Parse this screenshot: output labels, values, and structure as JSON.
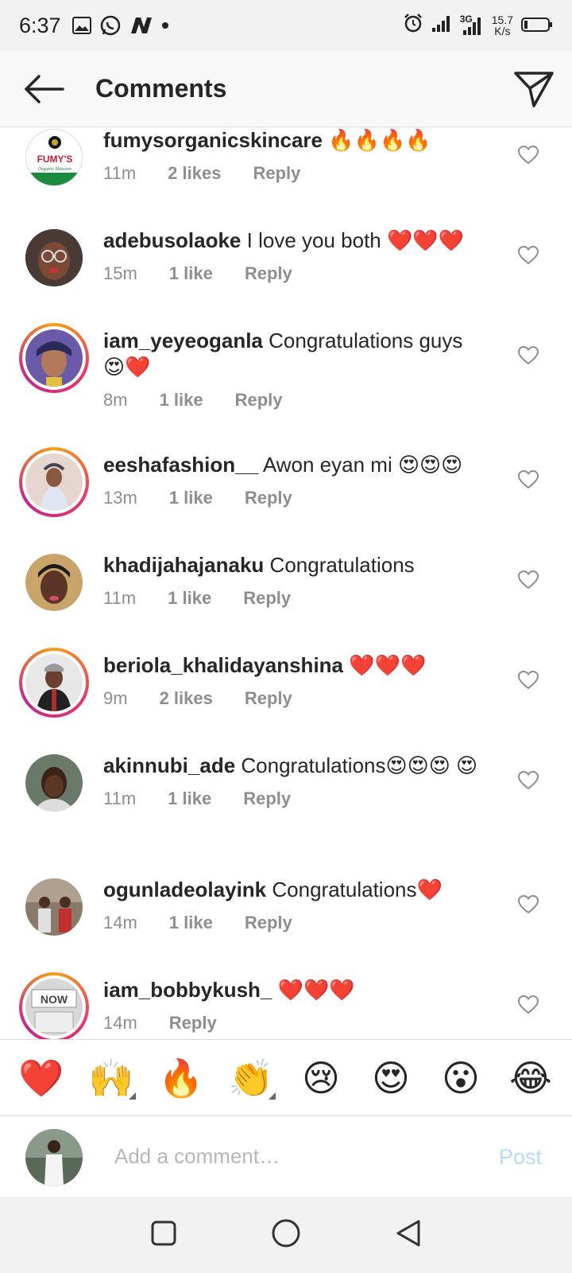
{
  "status": {
    "time": "6:37",
    "network": "3G",
    "speed_value": "15.7",
    "speed_unit": "K/s"
  },
  "header": {
    "title": "Comments",
    "back_icon": "back-arrow-icon",
    "send_icon": "send-icon"
  },
  "comments": [
    {
      "user": "fumysorganicskincare",
      "text": "🔥🔥🔥🔥",
      "time": "11m",
      "likes": "2 likes",
      "reply": "Reply",
      "avatar_logo": "FUMY'S",
      "avatar_sub": "Organic Skincare"
    },
    {
      "user": "adebusolaoke",
      "text": "I love you both ❤️❤️❤️",
      "time": "15m",
      "likes": "1 like",
      "reply": "Reply"
    },
    {
      "user": "iam_yeyeoganla",
      "text": "Congratulations guys 😍❤️",
      "time": "8m",
      "likes": "1 like",
      "reply": "Reply"
    },
    {
      "user": "eeshafashion__",
      "text": "Awon eyan mi 😍😍😍",
      "time": "13m",
      "likes": "1 like",
      "reply": "Reply"
    },
    {
      "user": "khadijahajanaku",
      "text": "Congratulations",
      "time": "11m",
      "likes": "1 like",
      "reply": "Reply"
    },
    {
      "user": "beriola_khalidayanshina",
      "text": "❤️❤️❤️",
      "time": "9m",
      "likes": "2 likes",
      "reply": "Reply"
    },
    {
      "user": "akinnubi_ade",
      "text": "Congratulations😍😍😍 😍",
      "time": "11m",
      "likes": "1 like",
      "reply": "Reply"
    },
    {
      "user": "ogunladeolayink",
      "text": "Congratulations❤️",
      "time": "14m",
      "likes": "1 like",
      "reply": "Reply"
    },
    {
      "user": "iam_bobbykush_",
      "text": "❤️❤️❤️",
      "time": "14m",
      "likes": "Reply",
      "reply": "",
      "avatar_logo": "NOW"
    }
  ],
  "reactions": [
    "❤️",
    "🙌",
    "🔥",
    "👏",
    "😢",
    "😍",
    "😮",
    "😂"
  ],
  "composer": {
    "placeholder": "Add a comment…",
    "post_label": "Post"
  },
  "colors": {
    "post_disabled": "#b3dbff",
    "meta_gray": "#8e8e8e",
    "story_ring": "#e6366b"
  }
}
